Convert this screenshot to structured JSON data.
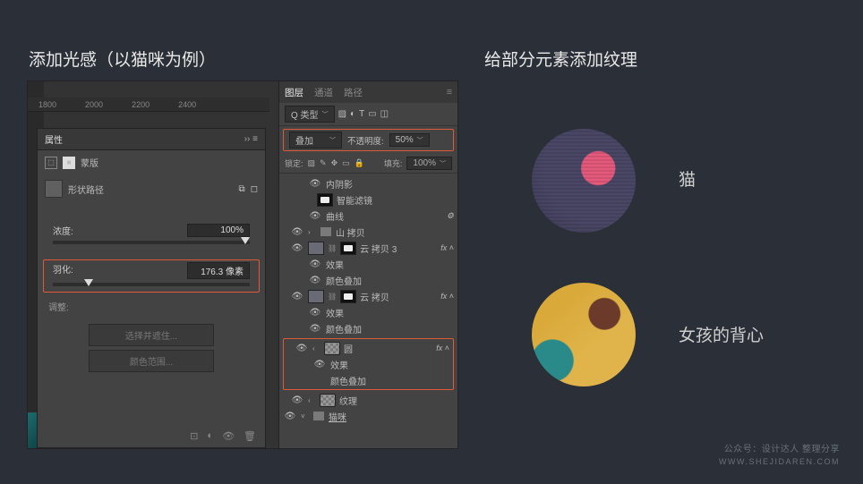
{
  "headings": {
    "left": "添加光感（以猫咪为例）",
    "right": "给部分元素添加纹理"
  },
  "ruler": {
    "ticks": [
      "1800",
      "2000",
      "2200",
      "2400"
    ]
  },
  "properties": {
    "tab": "属性",
    "mask_label": "蒙版",
    "shape_path_label": "形状路径",
    "density": {
      "label": "浓度:",
      "value": "100%"
    },
    "feather": {
      "label": "羽化:",
      "value": "176.3 像素"
    },
    "adjust_label": "调整:",
    "btn_select_mask": "选择并遮住...",
    "btn_color_range": "颜色范围..."
  },
  "layers_panel": {
    "tabs": {
      "layers": "图层",
      "channels": "通道",
      "paths": "路径"
    },
    "filter_label": "Q 类型",
    "blend": {
      "mode": "叠加",
      "opacity_label": "不透明度:",
      "opacity": "50%"
    },
    "lock": {
      "label": "锁定:",
      "fill_label": "填充:",
      "fill": "100%"
    },
    "rows": {
      "inner_shadow": "内阴影",
      "smart_filters": "智能滤镜",
      "curves": "曲线",
      "group_mountain": "山 拷贝",
      "cloud_copy_3": "云 拷贝 3",
      "effects": "效果",
      "color_overlay": "颜色叠加",
      "cloud_copy": "云 拷贝",
      "circle": "圆",
      "texture": "纹理",
      "cat": "猫咪"
    },
    "fx_label": "fx"
  },
  "textures": {
    "label1": "猫",
    "label2": "女孩的背心"
  },
  "watermark": {
    "line1": "公众号：设计达人 整理分享",
    "line2": "WWW.SHEJIDAREN.COM"
  }
}
